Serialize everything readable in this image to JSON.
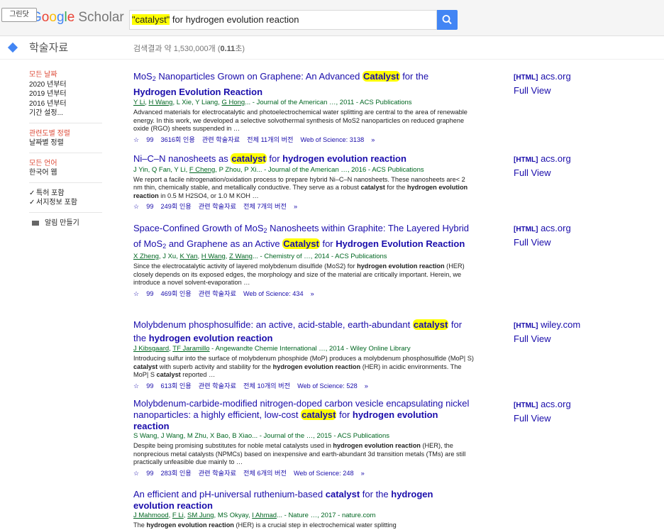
{
  "header": {
    "snap_badge": "그린닷",
    "logo_text_1": "G",
    "logo_text_2": "o",
    "logo_text_3": "o",
    "logo_text_4": "g",
    "logo_text_5": "l",
    "logo_text_6": "e",
    "logo_scholar": "Scholar",
    "search_value_q1": "\"catalyst\"",
    "search_value_rest": " for hydrogen evolution reaction",
    "search_icon": "search-icon"
  },
  "subheader": {
    "label": "학술자료",
    "count_prefix": "검색결과 약 1,530,000개 (",
    "count_time": "0.11",
    "count_suffix": "초)"
  },
  "sidebar": {
    "time": [
      "모든 날짜",
      "2020 년부터",
      "2019 년부터",
      "2016 년부터",
      "기간 설정..."
    ],
    "sort": [
      "관련도별 정렬",
      "날짜별 정렬"
    ],
    "lang": [
      "모든 언어",
      "한국어 웹"
    ],
    "checks": [
      "특허 포함",
      "서지정보 포함"
    ],
    "alert": "알림 만들기"
  },
  "results": [
    {
      "t1": "MoS",
      "t1sub": "2",
      "t2": " Nanoparticles Grown on Graphene: An Advanced ",
      "hl": "Catalyst",
      "t3": " for the",
      "t4": "Hydrogen Evolution Reaction",
      "authors_a": "Y Li",
      "authors_b": "H Wang",
      "authors_c": ", L Xie, Y Liang, ",
      "authors_d": "G Hong",
      "authors_e": "... - Journal of the American …, 2011 - ACS Publications",
      "snip": "Advanced materials for electrocatalytic and photoelectrochemical water splitting are central to the area of renewable energy. In this work, we developed a selective solvothermal synthesis of MoS2 nanoparticles on reduced graphene oxide (RGO) sheets suspended in …",
      "cite": "3616회 인용",
      "related": "관련 학술자료",
      "versions": "전체 11개의 버전",
      "wos": "Web of Science: 3138",
      "side_tag": "[HTML]",
      "side_site": "acs.org",
      "side_full": "Full View"
    },
    {
      "t1": "Ni–C–N nanosheets as ",
      "hl": "catalyst",
      "t3": " for ",
      "t4": "hydrogen evolution reaction",
      "authors": "J Yin, Q Fan, Y Li, ",
      "authors_u": "F Cheng",
      "authors_rest": ", P Zhou, P Xi... - Journal of the American …, 2016 - ACS Publications",
      "snip_a": "We report a facile nitrogenation/oxidation process to prepare hybrid Ni–C–N nanosheets. These nanosheets are< 2 nm thin, chemically stable, and metallically conductive. They serve as a robust ",
      "snip_b1": "catalyst",
      "snip_c": " for the ",
      "snip_b2": "hydrogen evolution reaction",
      "snip_d": " in 0.5 M H2SO4, or 1.0 M KOH …",
      "cite": "249회 인용",
      "related": "관련 학술자료",
      "versions": "전체 7개의 버전",
      "side_tag": "[HTML]",
      "side_site": "acs.org",
      "side_full": "Full View"
    },
    {
      "t1": "Space-Confined Growth of MoS",
      "t1sub": "2",
      "t2": " Nanosheets within Graphite: The Layered Hybrid of MoS",
      "t2sub": "2",
      "t3": " and Graphene as an Active ",
      "hl": "Catalyst",
      "t4": " for ",
      "t5": "Hydrogen Evolution Reaction",
      "authors_a": "X Zheng",
      "authors_b": ", J Xu, ",
      "authors_c": "K Yan",
      "authors_d": ", ",
      "authors_e": "H Wang",
      "authors_f": ", ",
      "authors_g": "Z Wang",
      "authors_h": "... - Chemistry of …, 2014 - ACS Publications",
      "snip_a": "Since the electrocatalytic activity of layered molybdenum disulfide (MoS2) for ",
      "snip_b": "hydrogen evolution reaction",
      "snip_c": " (HER) closely depends on its exposed edges, the morphology and size of the material are critically important. Herein, we introduce a novel solvent-evaporation …",
      "cite": "469회 인용",
      "related": "관련 학술자료",
      "wos": "Web of Science: 434",
      "side_tag": "[HTML]",
      "side_site": "acs.org",
      "side_full": "Full View"
    },
    {
      "t1": "Molybdenum phosphosulfide: an active, acid-stable, earth-abundant ",
      "hl": "catalyst",
      "t3": " for the ",
      "t4": "hydrogen evolution reaction",
      "authors_a": "J Kibsgaard",
      "authors_b": ", ",
      "authors_c": "TF Jaramillo",
      "authors_d": " - Angewandte Chemie International …, 2014 - Wiley Online Library",
      "snip_a": "Introducing sulfur into the surface of molybdenum phosphide (MoP) produces a molybdenum phosphosulfide (MoP| S) ",
      "snip_b1": "catalyst",
      "snip_c": " with superb activity and stability for the ",
      "snip_b2": "hydrogen evolution reaction",
      "snip_d": " (HER) in acidic environments. The MoP| S ",
      "snip_b3": "catalyst",
      "snip_e": " reported …",
      "cite": "613회 인용",
      "related": "관련 학술자료",
      "versions": "전체 10개의 버전",
      "wos": "Web of Science: 528",
      "side_tag": "[HTML]",
      "side_site": "wiley.com",
      "side_full": "Full View"
    },
    {
      "t1": "Molybdenum-carbide-modified nitrogen-doped carbon vesicle encapsulating nickel nanoparticles: a highly efficient, low-cost ",
      "hl": "catalyst",
      "t3": " for ",
      "t4": "hydrogen evolution reaction",
      "authors": "S Wang, J Wang, M Zhu, X Bao, B Xiao... - Journal of the …, 2015 - ACS Publications",
      "snip_a": "Despite being promising substitutes for noble metal catalysts used in ",
      "snip_b": "hydrogen evolution reaction",
      "snip_c": " (HER), the nonprecious metal catalysts (NPMCs) based on inexpensive and earth-abundant 3d transition metals (TMs) are still practically unfeasible due mainly to …",
      "cite": "283회 인용",
      "related": "관련 학술자료",
      "versions": "전체 6개의 버전",
      "wos": "Web of Science: 248",
      "side_tag": "[HTML]",
      "side_site": "acs.org",
      "side_full": "Full View"
    },
    {
      "t1": "An efficient and pH-universal ruthenium-based ",
      "t2": "catalyst",
      "t3": " for the ",
      "t4": "hydrogen evolution reaction",
      "authors_a": "J Mahmood",
      "authors_b": ", ",
      "authors_c": "F Li",
      "authors_d": ", ",
      "authors_e": "SM Jung",
      "authors_f": ", MS Okyay, ",
      "authors_g": "I Ahmad",
      "authors_h": "... - Nature …, 2017 - nature.com",
      "snip_a": "The ",
      "snip_b": "hydrogen evolution reaction",
      "snip_c": " (HER) is a crucial step in electrochemical water splitting"
    }
  ]
}
